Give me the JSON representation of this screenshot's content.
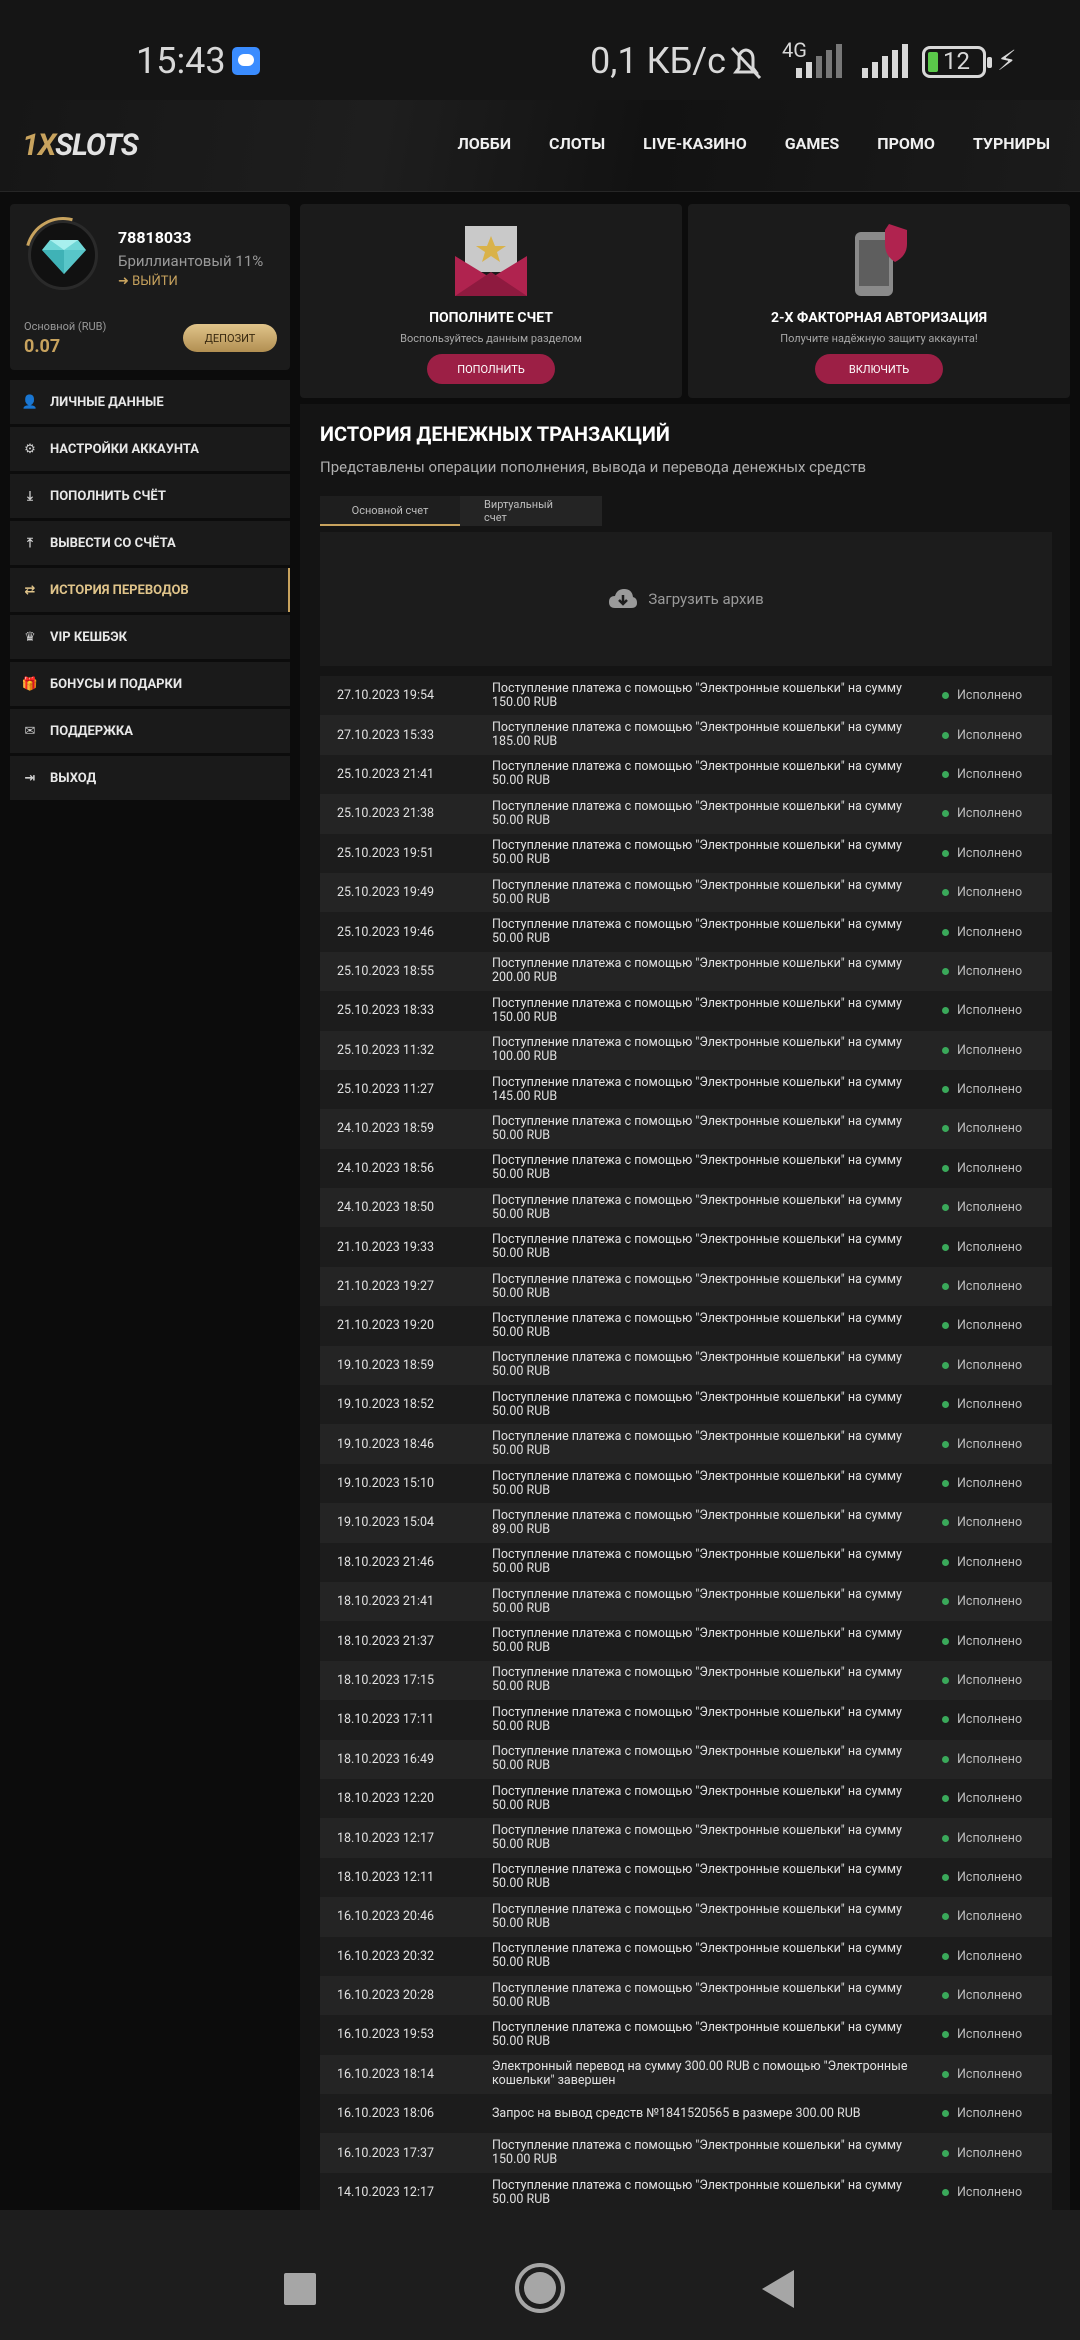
{
  "status_bar": {
    "time": "15:43",
    "speed": "0,1 КБ/с",
    "network": "4G",
    "battery": "12"
  },
  "header": {
    "logo_part1": "1X",
    "logo_part2": "SLOTS",
    "nav": [
      "ЛОББИ",
      "СЛОТЫ",
      "LIVE-КАЗИНО",
      "GAMES",
      "ПРОМО",
      "ТУРНИРЫ"
    ]
  },
  "profile": {
    "id": "78818033",
    "rank": "Бриллиантовый 11%",
    "logout": "ВЫЙТИ",
    "balance_label": "Основной (RUB)",
    "balance": "0.07",
    "deposit_button": "ДЕПОЗИТ"
  },
  "menu": [
    {
      "label": "ЛИЧНЫЕ ДАННЫЕ",
      "icon": "user-plus-icon"
    },
    {
      "label": "НАСТРОЙКИ АККАУНТА",
      "icon": "gears-icon"
    },
    {
      "label": "ПОПОЛНИТЬ СЧЁТ",
      "icon": "download-icon"
    },
    {
      "label": "ВЫВЕСТИ СО СЧЁТА",
      "icon": "upload-icon"
    },
    {
      "label": "ИСТОРИЯ ПЕРЕВОДОВ",
      "icon": "exchange-icon",
      "active": true
    },
    {
      "label": "VIP КЕШБЭК",
      "icon": "crown-icon"
    },
    {
      "label": "БОНУСЫ И ПОДАРКИ",
      "icon": "gift-icon"
    },
    {
      "label": "ПОДДЕРЖКА",
      "icon": "envelope-icon"
    },
    {
      "label": "ВЫХОД",
      "icon": "sign-out-icon"
    }
  ],
  "promo": [
    {
      "title": "ПОПОЛНИТЕ СЧЕТ",
      "subtitle": "Воспользуйтесь данным разделом",
      "button": "ПОПОЛНИТЬ",
      "icon": "envelope-star-icon"
    },
    {
      "title": "2-Х ФАКТОРНАЯ АВТОРИЗАЦИЯ",
      "subtitle": "Получите надёжную защиту аккаунта!",
      "button": "ВКЛЮЧИТЬ",
      "icon": "phone-shield-icon"
    }
  ],
  "main": {
    "title": "ИСТОРИЯ ДЕНЕЖНЫХ ТРАНЗАКЦИЙ",
    "subtitle": "Представлены операции пополнения, вывода и перевода денежных средств",
    "tabs": [
      "Основной счет",
      "Виртуальный счет"
    ],
    "archive_label": "Загрузить архив"
  },
  "transactions": [
    {
      "date": "27.10.2023 19:54",
      "desc": "Поступление платежа с помощью \"Электронные кошельки\" на сумму 150.00 RUB",
      "status": "Исполнено"
    },
    {
      "date": "27.10.2023 15:33",
      "desc": "Поступление платежа с помощью \"Электронные кошельки\" на сумму 185.00 RUB",
      "status": "Исполнено"
    },
    {
      "date": "25.10.2023 21:41",
      "desc": "Поступление платежа с помощью \"Электронные кошельки\" на сумму 50.00 RUB",
      "status": "Исполнено"
    },
    {
      "date": "25.10.2023 21:38",
      "desc": "Поступление платежа с помощью \"Электронные кошельки\" на сумму 50.00 RUB",
      "status": "Исполнено"
    },
    {
      "date": "25.10.2023 19:51",
      "desc": "Поступление платежа с помощью \"Электронные кошельки\" на сумму 50.00 RUB",
      "status": "Исполнено"
    },
    {
      "date": "25.10.2023 19:49",
      "desc": "Поступление платежа с помощью \"Электронные кошельки\" на сумму 50.00 RUB",
      "status": "Исполнено"
    },
    {
      "date": "25.10.2023 19:46",
      "desc": "Поступление платежа с помощью \"Электронные кошельки\" на сумму 50.00 RUB",
      "status": "Исполнено"
    },
    {
      "date": "25.10.2023 18:55",
      "desc": "Поступление платежа с помощью \"Электронные кошельки\" на сумму 200.00 RUB",
      "status": "Исполнено"
    },
    {
      "date": "25.10.2023 18:33",
      "desc": "Поступление платежа с помощью \"Электронные кошельки\" на сумму 150.00 RUB",
      "status": "Исполнено"
    },
    {
      "date": "25.10.2023 11:32",
      "desc": "Поступление платежа с помощью \"Электронные кошельки\" на сумму 100.00 RUB",
      "status": "Исполнено"
    },
    {
      "date": "25.10.2023 11:27",
      "desc": "Поступление платежа с помощью \"Электронные кошельки\" на сумму 145.00 RUB",
      "status": "Исполнено"
    },
    {
      "date": "24.10.2023 18:59",
      "desc": "Поступление платежа с помощью \"Электронные кошельки\" на сумму 50.00 RUB",
      "status": "Исполнено"
    },
    {
      "date": "24.10.2023 18:56",
      "desc": "Поступление платежа с помощью \"Электронные кошельки\" на сумму 50.00 RUB",
      "status": "Исполнено"
    },
    {
      "date": "24.10.2023 18:50",
      "desc": "Поступление платежа с помощью \"Электронные кошельки\" на сумму 50.00 RUB",
      "status": "Исполнено"
    },
    {
      "date": "21.10.2023 19:33",
      "desc": "Поступление платежа с помощью \"Электронные кошельки\" на сумму 50.00 RUB",
      "status": "Исполнено"
    },
    {
      "date": "21.10.2023 19:27",
      "desc": "Поступление платежа с помощью \"Электронные кошельки\" на сумму 50.00 RUB",
      "status": "Исполнено"
    },
    {
      "date": "21.10.2023 19:20",
      "desc": "Поступление платежа с помощью \"Электронные кошельки\" на сумму 50.00 RUB",
      "status": "Исполнено"
    },
    {
      "date": "19.10.2023 18:59",
      "desc": "Поступление платежа с помощью \"Электронные кошельки\" на сумму 50.00 RUB",
      "status": "Исполнено"
    },
    {
      "date": "19.10.2023 18:52",
      "desc": "Поступление платежа с помощью \"Электронные кошельки\" на сумму 50.00 RUB",
      "status": "Исполнено"
    },
    {
      "date": "19.10.2023 18:46",
      "desc": "Поступление платежа с помощью \"Электронные кошельки\" на сумму 50.00 RUB",
      "status": "Исполнено"
    },
    {
      "date": "19.10.2023 15:10",
      "desc": "Поступление платежа с помощью \"Электронные кошельки\" на сумму 50.00 RUB",
      "status": "Исполнено"
    },
    {
      "date": "19.10.2023 15:04",
      "desc": "Поступление платежа с помощью \"Электронные кошельки\" на сумму 89.00 RUB",
      "status": "Исполнено"
    },
    {
      "date": "18.10.2023 21:46",
      "desc": "Поступление платежа с помощью \"Электронные кошельки\" на сумму 50.00 RUB",
      "status": "Исполнено"
    },
    {
      "date": "18.10.2023 21:41",
      "desc": "Поступление платежа с помощью \"Электронные кошельки\" на сумму 50.00 RUB",
      "status": "Исполнено"
    },
    {
      "date": "18.10.2023 21:37",
      "desc": "Поступление платежа с помощью \"Электронные кошельки\" на сумму 50.00 RUB",
      "status": "Исполнено"
    },
    {
      "date": "18.10.2023 17:15",
      "desc": "Поступление платежа с помощью \"Электронные кошельки\" на сумму 50.00 RUB",
      "status": "Исполнено"
    },
    {
      "date": "18.10.2023 17:11",
      "desc": "Поступление платежа с помощью \"Электронные кошельки\" на сумму 50.00 RUB",
      "status": "Исполнено"
    },
    {
      "date": "18.10.2023 16:49",
      "desc": "Поступление платежа с помощью \"Электронные кошельки\" на сумму 50.00 RUB",
      "status": "Исполнено"
    },
    {
      "date": "18.10.2023 12:20",
      "desc": "Поступление платежа с помощью \"Электронные кошельки\" на сумму 50.00 RUB",
      "status": "Исполнено"
    },
    {
      "date": "18.10.2023 12:17",
      "desc": "Поступление платежа с помощью \"Электронные кошельки\" на сумму 50.00 RUB",
      "status": "Исполнено"
    },
    {
      "date": "18.10.2023 12:11",
      "desc": "Поступление платежа с помощью \"Электронные кошельки\" на сумму 50.00 RUB",
      "status": "Исполнено"
    },
    {
      "date": "16.10.2023 20:46",
      "desc": "Поступление платежа с помощью \"Электронные кошельки\" на сумму 50.00 RUB",
      "status": "Исполнено"
    },
    {
      "date": "16.10.2023 20:32",
      "desc": "Поступление платежа с помощью \"Электронные кошельки\" на сумму 50.00 RUB",
      "status": "Исполнено"
    },
    {
      "date": "16.10.2023 20:28",
      "desc": "Поступление платежа с помощью \"Электронные кошельки\" на сумму 50.00 RUB",
      "status": "Исполнено"
    },
    {
      "date": "16.10.2023 19:53",
      "desc": "Поступление платежа с помощью \"Электронные кошельки\" на сумму 50.00 RUB",
      "status": "Исполнено"
    },
    {
      "date": "16.10.2023 18:14",
      "desc": "Электронный перевод на сумму 300.00 RUB с помощью \"Электронные кошельки\" завершен",
      "status": "Исполнено"
    },
    {
      "date": "16.10.2023 18:06",
      "desc": "Запрос на вывод средств №1841520565 в размере 300.00 RUB",
      "status": "Исполнено"
    },
    {
      "date": "16.10.2023 17:37",
      "desc": "Поступление платежа с помощью \"Электронные кошельки\" на сумму 150.00 RUB",
      "status": "Исполнено"
    },
    {
      "date": "14.10.2023 12:17",
      "desc": "Поступление платежа с помощью \"Электронные кошельки\" на сумму 50.00 RUB",
      "status": "Исполнено"
    }
  ]
}
